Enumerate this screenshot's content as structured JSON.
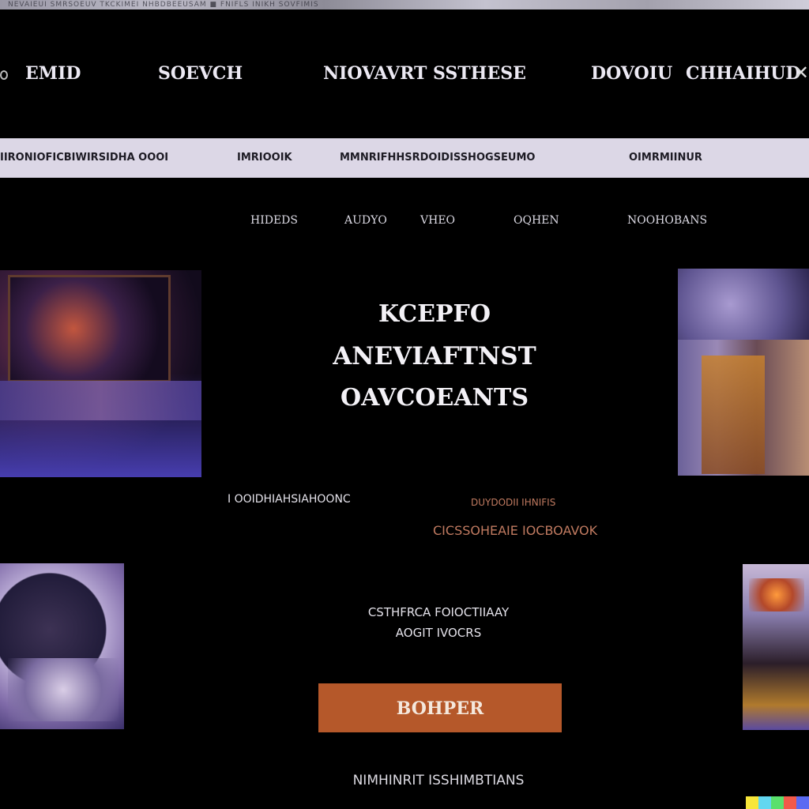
{
  "browser": {
    "strip_text": "NEVAIEUI SMRSOEUV TKCKIMEI NHBDBEEUSAM  ■  FNIFLS INIKH SOVFIMIS"
  },
  "nav": {
    "items": [
      "EMID",
      "SOEVCH",
      "NIOVAVRT SSTHESE",
      "DOVOIU",
      "CHHAIHUD"
    ]
  },
  "subnav": {
    "items": [
      "IIRONIOFICBIWIRSIDHA OOOI",
      "IMRIOOIK",
      "MMNRIFHHSRDOIDISSHOGSEUMO",
      "OIMRMIINUR"
    ]
  },
  "categories": [
    "HIDEDS",
    "AUDYO",
    "VHEO",
    "OQHEN",
    "NOOHOBANS"
  ],
  "hero": {
    "line1": "KCEPFO",
    "line2": "ANEVIAFTNST",
    "line3": "OAVCOEANTS"
  },
  "meta": {
    "left": "I OOIDHIAHSIAHOONC",
    "right1": "DUYDODII IHNIFIS",
    "right2": "CICSSOHEAIE IOCBOAVOK"
  },
  "body": {
    "line1": "CSTHFRCA FOIOCTIIAAY",
    "line2": "AOGIT IVOCRS"
  },
  "cta": {
    "label": "BOHPER"
  },
  "footer": {
    "text": "NIMHINRIT ISSHIMBTIANS"
  },
  "colors": {
    "background": "#000000",
    "subnav_bg": "#dcd7e6",
    "cta_bg": "#b5582a",
    "accent_text": "#c07a60"
  },
  "watermark_colors": [
    "#f7e63a",
    "#62d7f0",
    "#5ae06c",
    "#f25a4a",
    "#5a6af2"
  ]
}
